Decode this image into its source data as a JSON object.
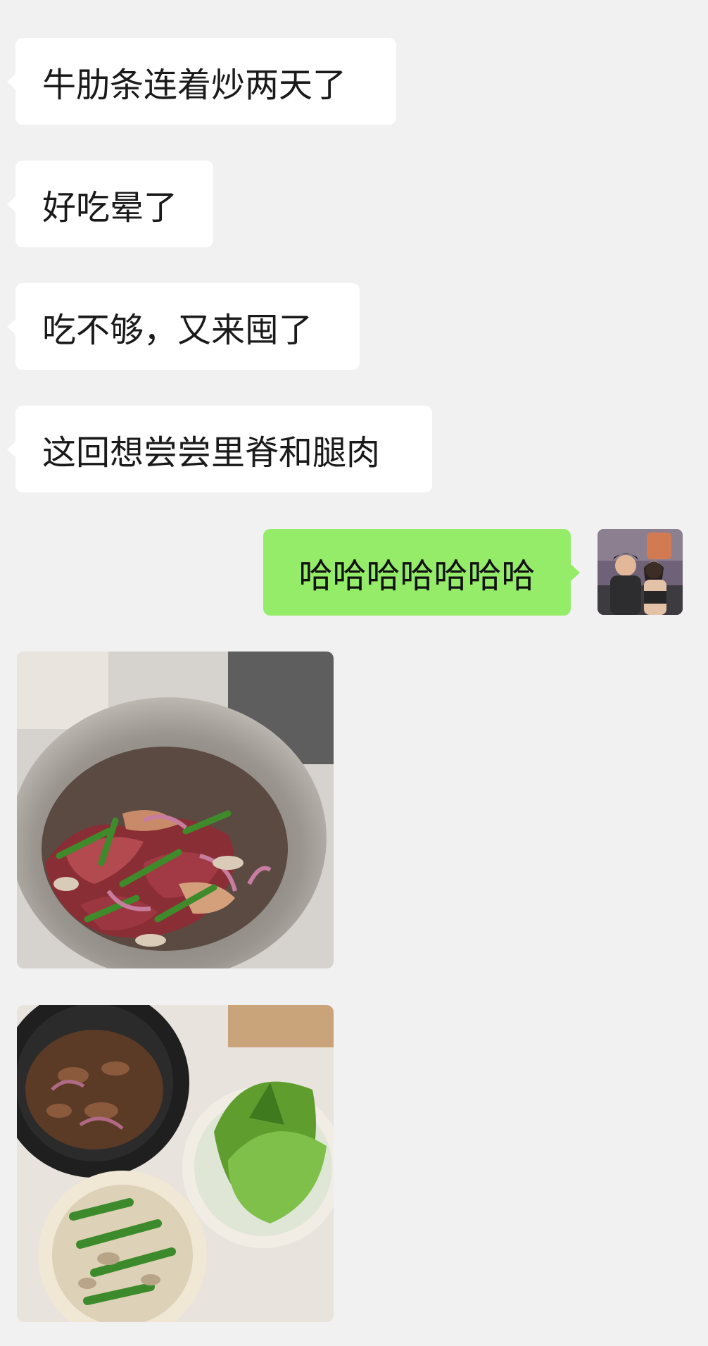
{
  "messages_incoming": [
    {
      "text": "牛肋条连着炒两天了"
    },
    {
      "text": "好吃晕了"
    },
    {
      "text": "吃不够，又来囤了"
    },
    {
      "text": "这回想尝尝里脊和腿肉"
    }
  ],
  "message_outgoing": {
    "text": "哈哈哈哈哈哈哈"
  },
  "colors": {
    "background": "#f1f1f1",
    "incoming_bubble": "#ffffff",
    "outgoing_bubble": "#95ec69"
  },
  "icons": {
    "avatar": "user-avatar",
    "photo_1": "stir-fry-beef-in-bowl-photo",
    "photo_2": "beef-with-lettuce-and-okra-photo"
  }
}
